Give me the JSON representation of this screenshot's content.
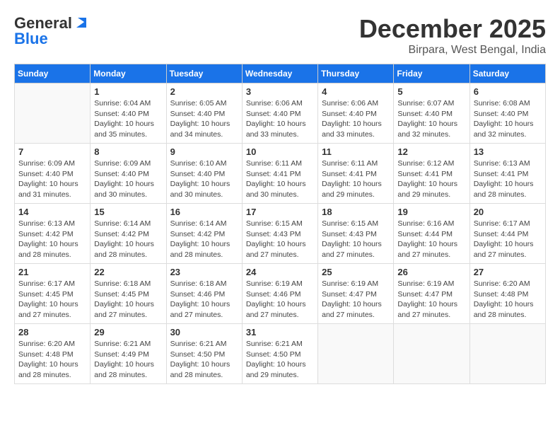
{
  "header": {
    "logo_general": "General",
    "logo_blue": "Blue",
    "month_title": "December 2025",
    "subtitle": "Birpara, West Bengal, India"
  },
  "days_of_week": [
    "Sunday",
    "Monday",
    "Tuesday",
    "Wednesday",
    "Thursday",
    "Friday",
    "Saturday"
  ],
  "weeks": [
    [
      {
        "day": "",
        "info": ""
      },
      {
        "day": "1",
        "info": "Sunrise: 6:04 AM\nSunset: 4:40 PM\nDaylight: 10 hours\nand 35 minutes."
      },
      {
        "day": "2",
        "info": "Sunrise: 6:05 AM\nSunset: 4:40 PM\nDaylight: 10 hours\nand 34 minutes."
      },
      {
        "day": "3",
        "info": "Sunrise: 6:06 AM\nSunset: 4:40 PM\nDaylight: 10 hours\nand 33 minutes."
      },
      {
        "day": "4",
        "info": "Sunrise: 6:06 AM\nSunset: 4:40 PM\nDaylight: 10 hours\nand 33 minutes."
      },
      {
        "day": "5",
        "info": "Sunrise: 6:07 AM\nSunset: 4:40 PM\nDaylight: 10 hours\nand 32 minutes."
      },
      {
        "day": "6",
        "info": "Sunrise: 6:08 AM\nSunset: 4:40 PM\nDaylight: 10 hours\nand 32 minutes."
      }
    ],
    [
      {
        "day": "7",
        "info": "Sunrise: 6:09 AM\nSunset: 4:40 PM\nDaylight: 10 hours\nand 31 minutes."
      },
      {
        "day": "8",
        "info": "Sunrise: 6:09 AM\nSunset: 4:40 PM\nDaylight: 10 hours\nand 30 minutes."
      },
      {
        "day": "9",
        "info": "Sunrise: 6:10 AM\nSunset: 4:40 PM\nDaylight: 10 hours\nand 30 minutes."
      },
      {
        "day": "10",
        "info": "Sunrise: 6:11 AM\nSunset: 4:41 PM\nDaylight: 10 hours\nand 30 minutes."
      },
      {
        "day": "11",
        "info": "Sunrise: 6:11 AM\nSunset: 4:41 PM\nDaylight: 10 hours\nand 29 minutes."
      },
      {
        "day": "12",
        "info": "Sunrise: 6:12 AM\nSunset: 4:41 PM\nDaylight: 10 hours\nand 29 minutes."
      },
      {
        "day": "13",
        "info": "Sunrise: 6:13 AM\nSunset: 4:41 PM\nDaylight: 10 hours\nand 28 minutes."
      }
    ],
    [
      {
        "day": "14",
        "info": "Sunrise: 6:13 AM\nSunset: 4:42 PM\nDaylight: 10 hours\nand 28 minutes."
      },
      {
        "day": "15",
        "info": "Sunrise: 6:14 AM\nSunset: 4:42 PM\nDaylight: 10 hours\nand 28 minutes."
      },
      {
        "day": "16",
        "info": "Sunrise: 6:14 AM\nSunset: 4:42 PM\nDaylight: 10 hours\nand 28 minutes."
      },
      {
        "day": "17",
        "info": "Sunrise: 6:15 AM\nSunset: 4:43 PM\nDaylight: 10 hours\nand 27 minutes."
      },
      {
        "day": "18",
        "info": "Sunrise: 6:15 AM\nSunset: 4:43 PM\nDaylight: 10 hours\nand 27 minutes."
      },
      {
        "day": "19",
        "info": "Sunrise: 6:16 AM\nSunset: 4:44 PM\nDaylight: 10 hours\nand 27 minutes."
      },
      {
        "day": "20",
        "info": "Sunrise: 6:17 AM\nSunset: 4:44 PM\nDaylight: 10 hours\nand 27 minutes."
      }
    ],
    [
      {
        "day": "21",
        "info": "Sunrise: 6:17 AM\nSunset: 4:45 PM\nDaylight: 10 hours\nand 27 minutes."
      },
      {
        "day": "22",
        "info": "Sunrise: 6:18 AM\nSunset: 4:45 PM\nDaylight: 10 hours\nand 27 minutes."
      },
      {
        "day": "23",
        "info": "Sunrise: 6:18 AM\nSunset: 4:46 PM\nDaylight: 10 hours\nand 27 minutes."
      },
      {
        "day": "24",
        "info": "Sunrise: 6:19 AM\nSunset: 4:46 PM\nDaylight: 10 hours\nand 27 minutes."
      },
      {
        "day": "25",
        "info": "Sunrise: 6:19 AM\nSunset: 4:47 PM\nDaylight: 10 hours\nand 27 minutes."
      },
      {
        "day": "26",
        "info": "Sunrise: 6:19 AM\nSunset: 4:47 PM\nDaylight: 10 hours\nand 27 minutes."
      },
      {
        "day": "27",
        "info": "Sunrise: 6:20 AM\nSunset: 4:48 PM\nDaylight: 10 hours\nand 28 minutes."
      }
    ],
    [
      {
        "day": "28",
        "info": "Sunrise: 6:20 AM\nSunset: 4:48 PM\nDaylight: 10 hours\nand 28 minutes."
      },
      {
        "day": "29",
        "info": "Sunrise: 6:21 AM\nSunset: 4:49 PM\nDaylight: 10 hours\nand 28 minutes."
      },
      {
        "day": "30",
        "info": "Sunrise: 6:21 AM\nSunset: 4:50 PM\nDaylight: 10 hours\nand 28 minutes."
      },
      {
        "day": "31",
        "info": "Sunrise: 6:21 AM\nSunset: 4:50 PM\nDaylight: 10 hours\nand 29 minutes."
      },
      {
        "day": "",
        "info": ""
      },
      {
        "day": "",
        "info": ""
      },
      {
        "day": "",
        "info": ""
      }
    ]
  ]
}
